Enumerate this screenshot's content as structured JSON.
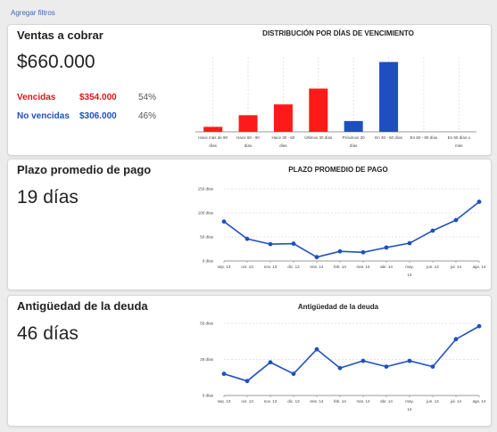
{
  "filter_link": "Agregar filtros",
  "cards": [
    {
      "title": "Ventas a cobrar",
      "value": "$660.000",
      "rows": [
        {
          "label": "Vencidas",
          "amount": "$354.000",
          "pct": "54%",
          "color": "#e01414"
        },
        {
          "label": "No vencidas",
          "amount": "$306.000",
          "pct": "46%",
          "color": "#1f4fbf"
        }
      ]
    },
    {
      "title": "Plazo promedio de pago",
      "value": "19 días"
    },
    {
      "title": "Antigüedad de la deuda",
      "value": "46 días"
    }
  ],
  "chart_data": [
    {
      "type": "bar",
      "title": "DISTRIBUCIÓN POR DÍAS DE VENCIMIENTO",
      "categories": [
        [
          "Hace más de 90",
          "días"
        ],
        [
          "Hace 60 - 90",
          "días"
        ],
        [
          "Hace 30 - 60",
          "días"
        ],
        [
          "Últimos 30 días"
        ],
        [
          "Próximos 30",
          "días"
        ],
        [
          "En 30 - 60 días"
        ],
        [
          "En 60 - 90 días"
        ],
        [
          "En 90 días o",
          "más"
        ]
      ],
      "values": [
        12,
        40,
        66,
        104,
        26,
        168,
        0,
        0
      ],
      "colors": [
        "#ff1a1a",
        "#ff1a1a",
        "#ff1a1a",
        "#ff1a1a",
        "#1f4fbf",
        "#1f4fbf",
        "#1f4fbf",
        "#1f4fbf"
      ],
      "ylim": [
        0,
        180
      ]
    },
    {
      "type": "line",
      "title": "PLAZO PROMEDIO DE PAGO",
      "categories": [
        [
          "sep. 13"
        ],
        [
          "oct. 13"
        ],
        [
          "nov. 13"
        ],
        [
          "dic. 13"
        ],
        [
          "ene. 14"
        ],
        [
          "feb. 14"
        ],
        [
          "mar. 14"
        ],
        [
          "abr. 14"
        ],
        [
          "may.",
          "14"
        ],
        [
          "jun. 14"
        ],
        [
          "jul. 14"
        ],
        [
          "ago. 14"
        ]
      ],
      "values": [
        82,
        46,
        35,
        36,
        8,
        20,
        18,
        28,
        37,
        63,
        85,
        123
      ],
      "y_ticks": [
        {
          "value": 0,
          "label": "0 días"
        },
        {
          "value": 50,
          "label": "50 días"
        },
        {
          "value": 100,
          "label": "100 días"
        },
        {
          "value": 150,
          "label": "150 días"
        }
      ],
      "ylim": [
        0,
        150
      ],
      "color": "#1f4fbf"
    },
    {
      "type": "line",
      "title": "Antigüedad de la deuda",
      "categories": [
        [
          "sep. 13"
        ],
        [
          "oct. 13"
        ],
        [
          "nov. 13"
        ],
        [
          "dic. 13"
        ],
        [
          "ene. 14"
        ],
        [
          "feb. 14"
        ],
        [
          "mar. 14"
        ],
        [
          "abr. 14"
        ],
        [
          "may.",
          "14"
        ],
        [
          "jun. 14"
        ],
        [
          "jul. 14"
        ],
        [
          "ago. 14"
        ]
      ],
      "values": [
        15,
        10,
        23,
        15,
        32,
        19,
        24,
        20,
        24,
        20,
        39,
        48
      ],
      "y_ticks": [
        {
          "value": 0,
          "label": "0 días"
        },
        {
          "value": 25,
          "label": "25 días"
        },
        {
          "value": 50,
          "label": "50 días"
        }
      ],
      "ylim": [
        0,
        50
      ],
      "color": "#1f4fbf"
    }
  ]
}
